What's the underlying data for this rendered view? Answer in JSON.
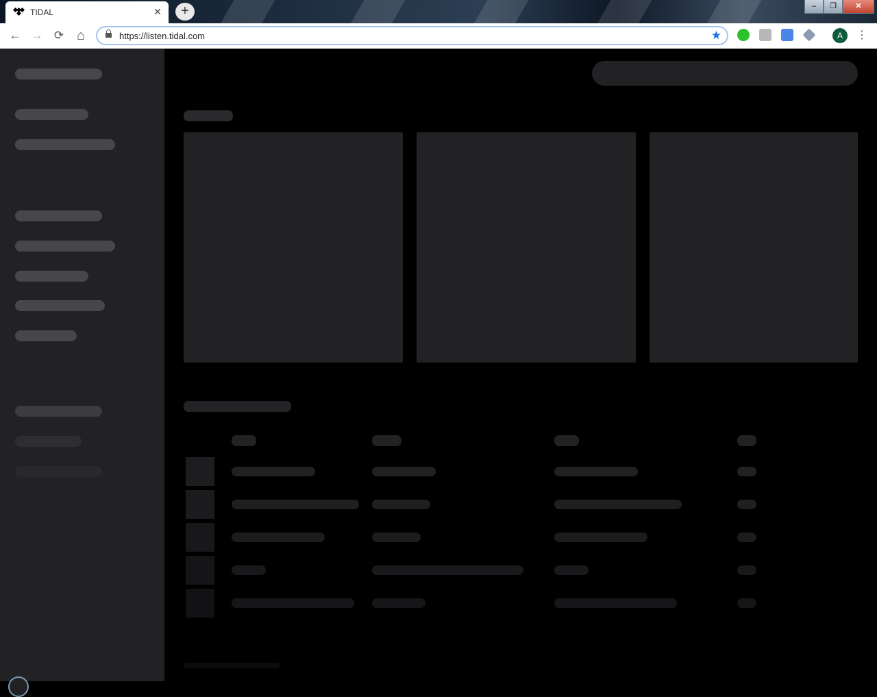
{
  "browser": {
    "tab_title": "TIDAL",
    "tab_close": "✕",
    "new_tab": "+",
    "url": "https://listen.tidal.com",
    "back": "←",
    "forward": "→",
    "reload": "⟳",
    "home": "⌂",
    "star": "★",
    "profile_initial": "A",
    "menu": "⋮",
    "window_minimize": "–",
    "window_restore": "❐",
    "window_close": "✕",
    "accent_color": "#1a73e8"
  },
  "page": {
    "state": "loading-skeleton",
    "background": "#000000",
    "sidebar_color": "#222225"
  }
}
